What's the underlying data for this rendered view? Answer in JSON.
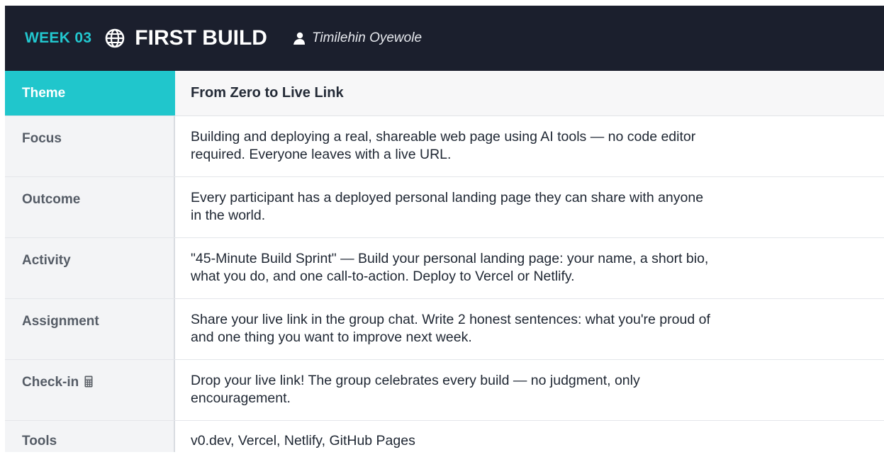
{
  "header": {
    "week": "WEEK 03",
    "globe_icon": "globe-icon",
    "title": "FIRST BUILD",
    "person_icon": "person-icon",
    "author": "Timilehin Oyewole",
    "accent_color": "#22c7cf",
    "background_color": "#1b1f2d"
  },
  "theme": {
    "label": "Theme",
    "value": "From Zero to Live Link"
  },
  "rows": [
    {
      "label": "Focus",
      "line1": "Building and deploying a real, shareable web page using AI tools — no code editor",
      "line2": "required. Everyone leaves with a live URL."
    },
    {
      "label": "Outcome",
      "line1": "Every participant has a deployed personal landing page they can share with anyone",
      "line2": "in the world."
    },
    {
      "label": "Activity",
      "line1": "\"45-Minute Build Sprint\" — Build your personal landing page: your name, a short bio,",
      "line2": "what you do, and one call-to-action. Deploy to Vercel or Netlify."
    },
    {
      "label": "Assignment",
      "line1": "Share your live link in the group chat. Write 2 honest sentences: what you're proud of",
      "line2": "and one thing you want to improve next week."
    },
    {
      "label": "Check-in",
      "icon": "calculator-icon",
      "line1": "Drop your live link! The group celebrates every build — no judgment, only",
      "line2": "encouragement."
    }
  ],
  "tools": {
    "label": "Tools",
    "value": "v0.dev, Vercel, Netlify, GitHub Pages"
  }
}
